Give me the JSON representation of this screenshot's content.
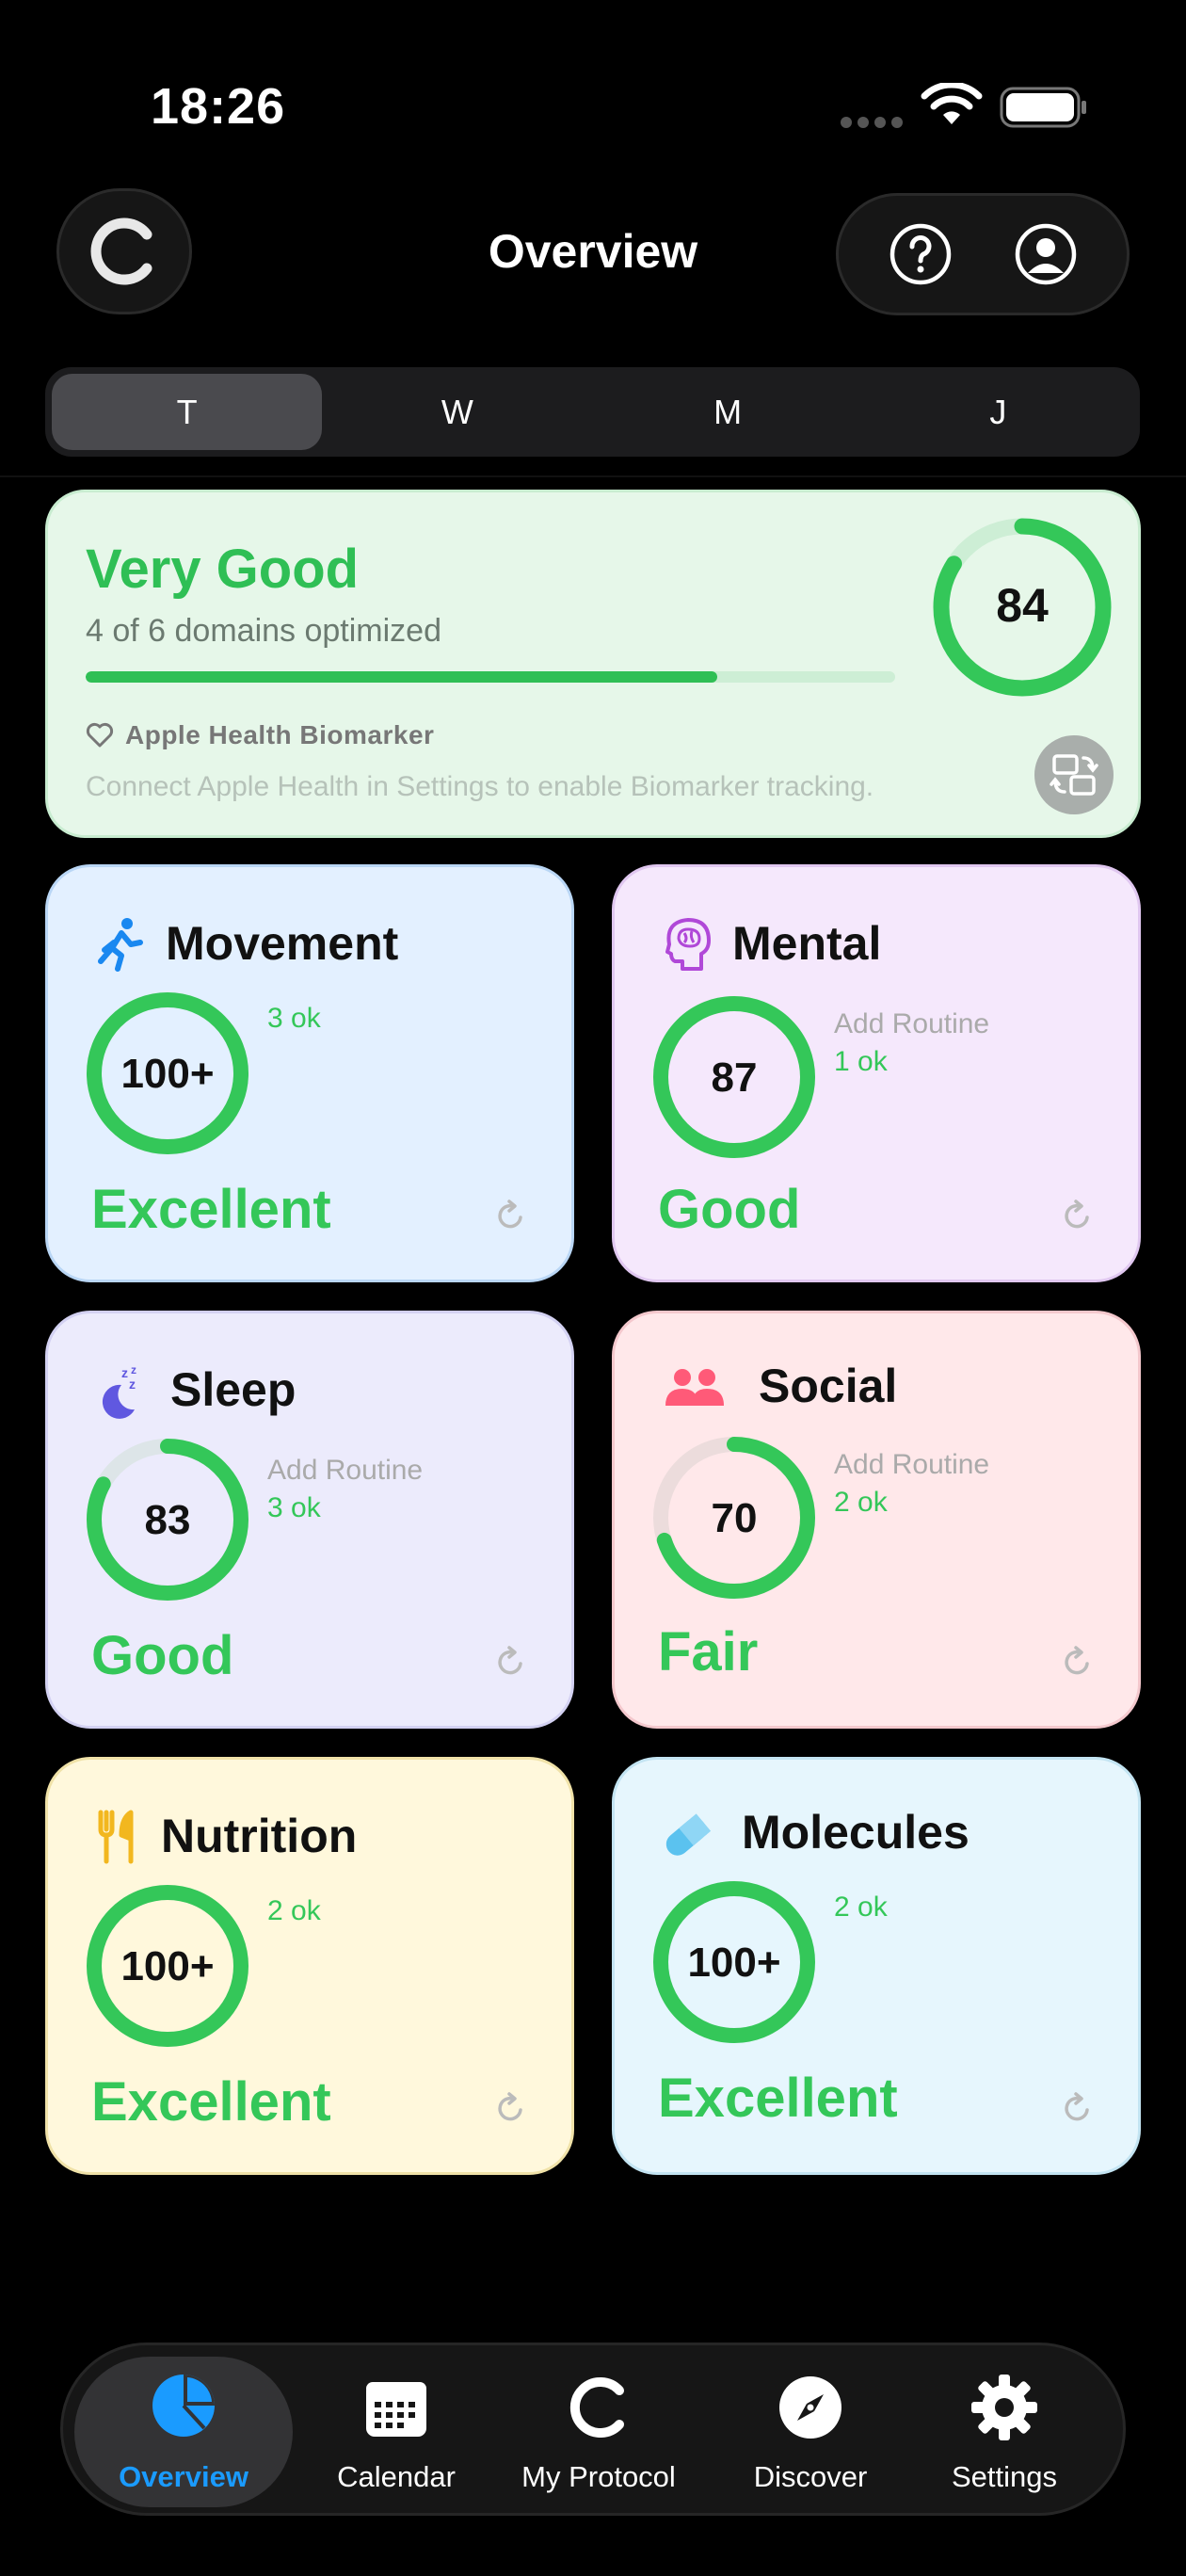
{
  "status_bar": {
    "time": "18:26"
  },
  "header": {
    "title": "Overview"
  },
  "tabs": [
    {
      "label": "T",
      "active": true
    },
    {
      "label": "W",
      "active": false
    },
    {
      "label": "M",
      "active": false
    },
    {
      "label": "J",
      "active": false
    }
  ],
  "summary": {
    "title": "Very Good",
    "subtitle": "4 of 6 domains optimized",
    "progress": 0.78,
    "score": "84",
    "score_progress": 0.84,
    "health_label": "Apple Health Biomarker",
    "health_note": "Connect Apple Health in Settings to enable Biomarker tracking."
  },
  "cards": {
    "movement": {
      "name": "Movement",
      "score": "100+",
      "progress": 1.0,
      "ok": "3 ok",
      "status": "Excellent"
    },
    "mental": {
      "name": "Mental",
      "score": "87",
      "progress": 1.0,
      "routine": "Add Routine",
      "ok": "1 ok",
      "status": "Good"
    },
    "sleep": {
      "name": "Sleep",
      "score": "83",
      "progress": 0.83,
      "routine": "Add Routine",
      "ok": "3 ok",
      "status": "Good"
    },
    "social": {
      "name": "Social",
      "score": "70",
      "progress": 0.7,
      "routine": "Add Routine",
      "ok": "2 ok",
      "status": "Fair"
    },
    "nutrition": {
      "name": "Nutrition",
      "score": "100+",
      "progress": 1.0,
      "ok": "2 ok",
      "status": "Excellent"
    },
    "molecules": {
      "name": "Molecules",
      "score": "100+",
      "progress": 1.0,
      "ok": "2 ok",
      "status": "Excellent"
    }
  },
  "tabbar": [
    {
      "label": "Overview",
      "icon": "pie-chart-icon",
      "active": true
    },
    {
      "label": "Calendar",
      "icon": "calendar-icon",
      "active": false
    },
    {
      "label": "My Protocol",
      "icon": "protocol-logo-icon",
      "active": false
    },
    {
      "label": "Discover",
      "icon": "compass-icon",
      "active": false
    },
    {
      "label": "Settings",
      "icon": "gear-icon",
      "active": false
    }
  ],
  "colors": {
    "accent_green": "#34c759",
    "accent_blue": "#1a9bff",
    "movement_bg": "#e3f0ff",
    "mental_bg": "#f5e8fc",
    "sleep_bg": "#ecebfc",
    "social_bg": "#ffe8ea",
    "nutrition_bg": "#fff8dc",
    "molecules_bg": "#e6f6fd"
  }
}
